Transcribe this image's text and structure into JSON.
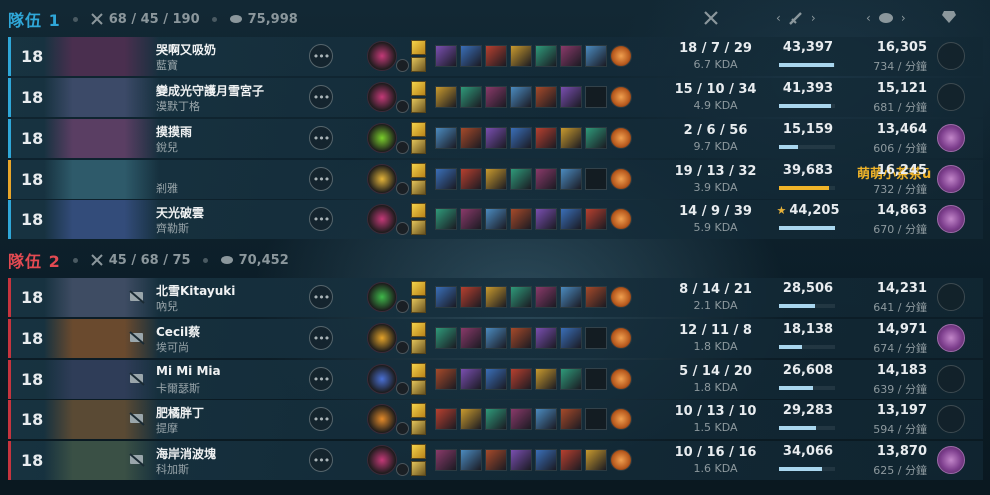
{
  "teams": [
    {
      "name": "隊伍 1",
      "kda_total": "68 / 45 / 190",
      "gold_total": "75,998",
      "players": [
        {
          "level": "18",
          "name": "哭啊又吸奶",
          "champion": "藍寶",
          "kda": "18 / 7 / 29",
          "kda_ratio": "6.7 KDA",
          "damage": "43,397",
          "damage_pct": 0.98,
          "gold": "16,305",
          "gpm": "734 / 分鐘",
          "honored": false,
          "name_color": "white",
          "muted": false,
          "star": false,
          "items": 7
        },
        {
          "level": "18",
          "name": "變成光守護月雪宮子",
          "champion": "漠默丁格",
          "kda": "15 / 10 / 34",
          "kda_ratio": "4.9 KDA",
          "damage": "41,393",
          "damage_pct": 0.93,
          "gold": "15,121",
          "gpm": "681 / 分鐘",
          "honored": false,
          "name_color": "white",
          "muted": false,
          "star": false,
          "items": 6
        },
        {
          "level": "18",
          "name": "摸摸雨",
          "champion": "銳兒",
          "kda": "2 / 6 / 56",
          "kda_ratio": "9.7 KDA",
          "damage": "15,159",
          "damage_pct": 0.34,
          "gold": "13,464",
          "gpm": "606 / 分鐘",
          "honored": true,
          "name_color": "white",
          "muted": false,
          "star": false,
          "items": 7
        },
        {
          "level": "18",
          "name": "萌萌小茶茶ū",
          "champion": "剎雅",
          "kda": "19 / 13 / 32",
          "kda_ratio": "3.9 KDA",
          "damage": "39,683",
          "damage_pct": 0.89,
          "gold": "16,245",
          "gpm": "732 / 分鐘",
          "honored": true,
          "name_color": "gold",
          "muted": false,
          "star": false,
          "items": 6
        },
        {
          "level": "18",
          "name": "天光破雲",
          "champion": "齊勒斯",
          "kda": "14 / 9 / 39",
          "kda_ratio": "5.9 KDA",
          "damage": "44,205",
          "damage_pct": 1.0,
          "gold": "14,863",
          "gpm": "670 / 分鐘",
          "honored": true,
          "name_color": "white",
          "muted": false,
          "star": true,
          "items": 7
        }
      ]
    },
    {
      "name": "隊伍 2",
      "kda_total": "45 / 68 / 75",
      "gold_total": "70,452",
      "players": [
        {
          "level": "18",
          "name": "北雪Kitayuki",
          "champion": "吶兒",
          "kda": "8 / 14 / 21",
          "kda_ratio": "2.1 KDA",
          "damage": "28,506",
          "damage_pct": 0.64,
          "gold": "14,231",
          "gpm": "641 / 分鐘",
          "honored": false,
          "name_color": "white",
          "muted": true,
          "star": false,
          "items": 7
        },
        {
          "level": "18",
          "name": "Cecil蔡",
          "champion": "埃可尚",
          "kda": "12 / 11 / 8",
          "kda_ratio": "1.8 KDA",
          "damage": "18,138",
          "damage_pct": 0.41,
          "gold": "14,971",
          "gpm": "674 / 分鐘",
          "honored": true,
          "name_color": "white",
          "muted": true,
          "star": false,
          "items": 6
        },
        {
          "level": "18",
          "name": "Mi Mi Mia",
          "champion": "卡爾瑟斯",
          "kda": "5 / 14 / 20",
          "kda_ratio": "1.8 KDA",
          "damage": "26,608",
          "damage_pct": 0.6,
          "gold": "14,183",
          "gpm": "639 / 分鐘",
          "honored": false,
          "name_color": "white",
          "muted": true,
          "star": false,
          "items": 6
        },
        {
          "level": "18",
          "name": "肥橘胖丁",
          "champion": "提摩",
          "kda": "10 / 13 / 10",
          "kda_ratio": "1.5 KDA",
          "damage": "29,283",
          "damage_pct": 0.66,
          "gold": "13,197",
          "gpm": "594 / 分鐘",
          "honored": false,
          "name_color": "white",
          "muted": true,
          "star": false,
          "items": 6
        },
        {
          "level": "18",
          "name": "海岸消波塊",
          "champion": "科加斯",
          "kda": "10 / 16 / 16",
          "kda_ratio": "1.6 KDA",
          "damage": "34,066",
          "damage_pct": 0.77,
          "gold": "13,870",
          "gpm": "625 / 分鐘",
          "honored": true,
          "name_color": "white",
          "muted": true,
          "star": false,
          "items": 7
        }
      ]
    }
  ],
  "colors": {
    "team1": "#2fa7d8",
    "team2": "#e34a52",
    "highlight": "#f0b429",
    "damage_bar": "#a9d6ee"
  }
}
